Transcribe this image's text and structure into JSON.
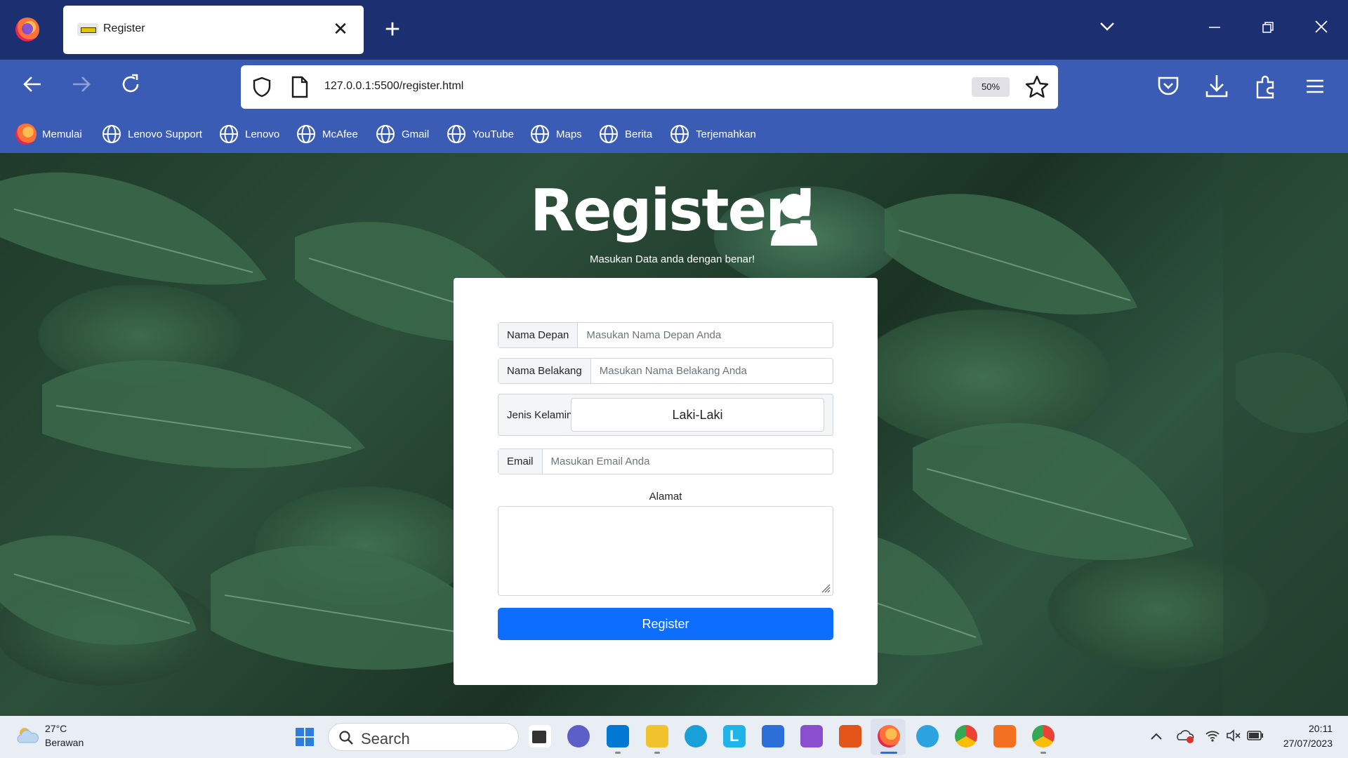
{
  "browser": {
    "tab_title": "Register",
    "url": "127.0.0.1:5500/register.html",
    "zoom": "50%",
    "bookmarks": [
      "Memulai",
      "Lenovo Support",
      "Lenovo",
      "McAfee",
      "Gmail",
      "YouTube",
      "Maps",
      "Berita",
      "Terjemahkan"
    ]
  },
  "page": {
    "heading": "Register!",
    "subheading": "Masukan Data anda dengan benar!",
    "form": {
      "first_name_label": "Nama Depan",
      "first_name_placeholder": "Masukan Nama Depan Anda",
      "last_name_label": "Nama Belakang",
      "last_name_placeholder": "Masukan Nama Belakang Anda",
      "gender_label": "Jenis Kelamin",
      "gender_value": "Laki-Laki",
      "email_label": "Email",
      "email_placeholder": "Masukan Email Anda",
      "address_label": "Alamat",
      "submit_label": "Register"
    }
  },
  "taskbar": {
    "weather_temp": "27°C",
    "weather_desc": "Berawan",
    "search_placeholder": "Search",
    "time": "20:11",
    "date": "27/07/2023"
  },
  "colors": {
    "tabbar": "#1c2f70",
    "navbar": "#3a5cb5",
    "primary_button": "#0d6efd"
  }
}
